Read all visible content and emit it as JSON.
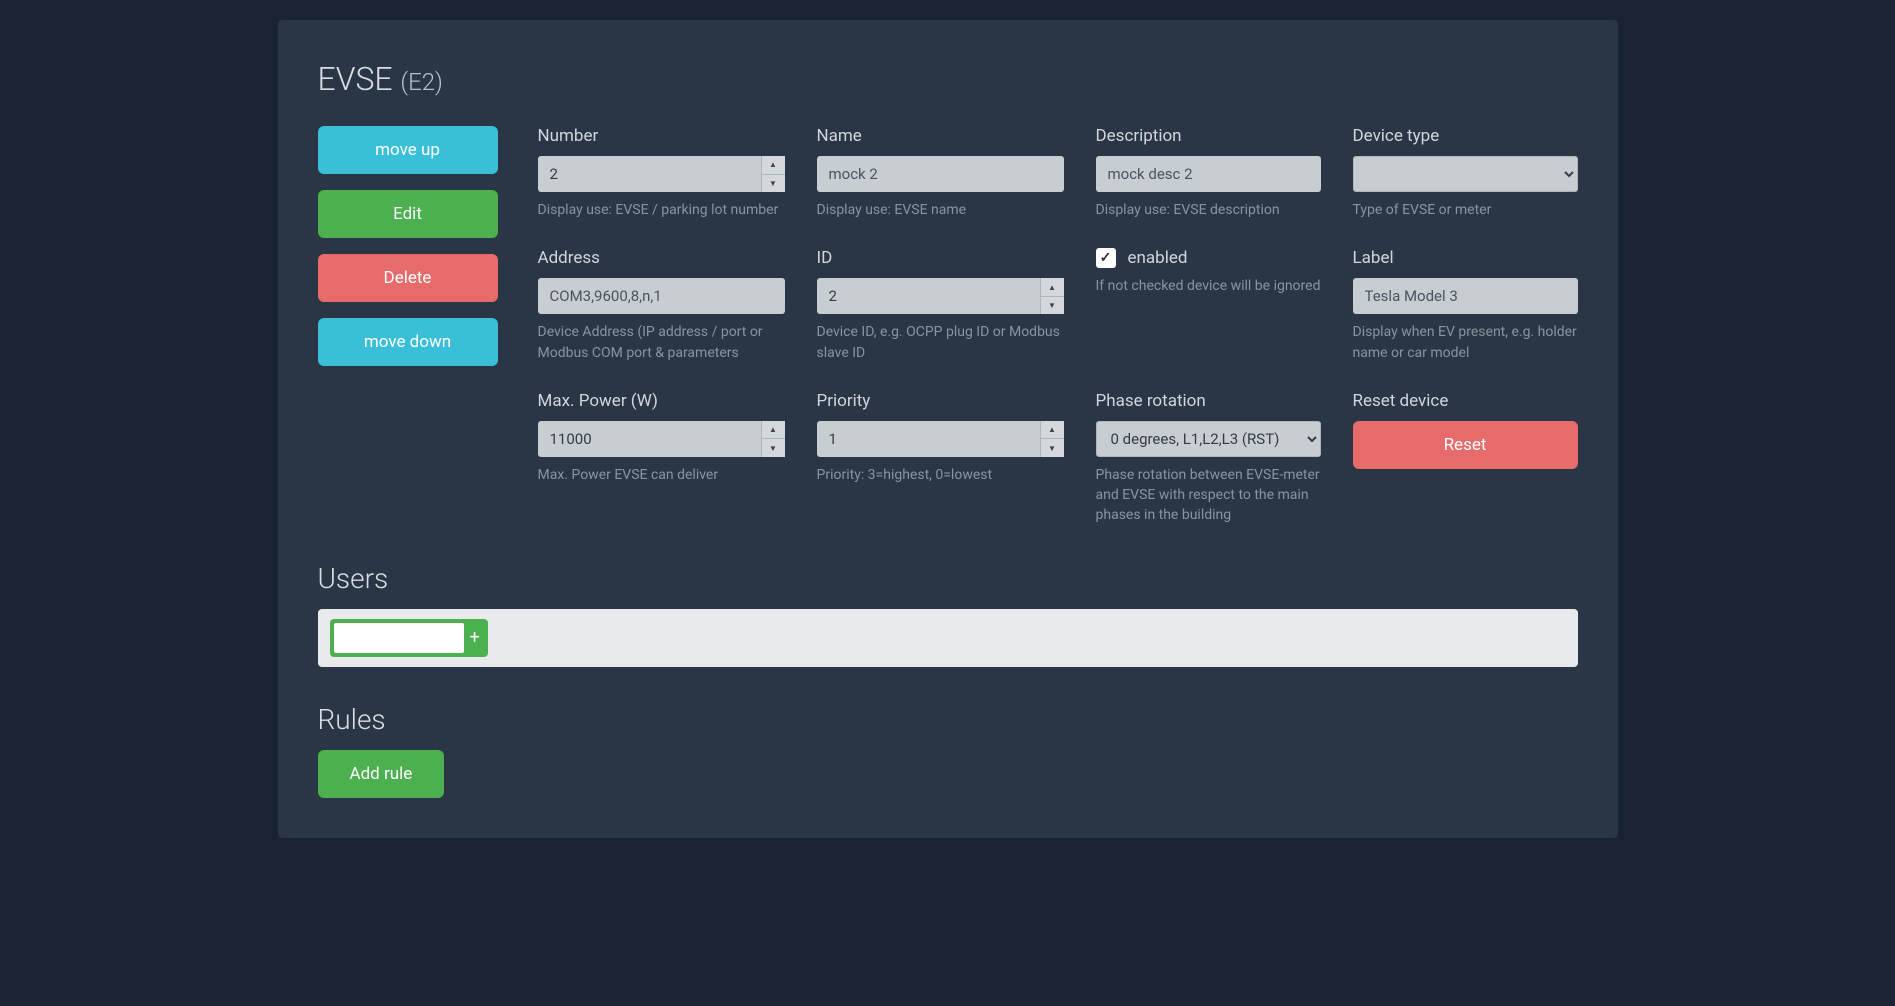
{
  "header": {
    "title": "EVSE",
    "subtitle": "(E2)"
  },
  "side": {
    "move_up": "move up",
    "edit": "Edit",
    "delete": "Delete",
    "move_down": "move down"
  },
  "fields": {
    "number": {
      "label": "Number",
      "value": "2",
      "help": "Display use: EVSE / parking lot number"
    },
    "name": {
      "label": "Name",
      "value": "mock 2",
      "help": "Display use: EVSE name"
    },
    "description": {
      "label": "Description",
      "value": "mock desc 2",
      "help": "Display use: EVSE description"
    },
    "device_type": {
      "label": "Device type",
      "value": "",
      "help": "Type of EVSE or meter"
    },
    "address": {
      "label": "Address",
      "value": "COM3,9600,8,n,1",
      "help": "Device Address (IP address / port or Modbus COM port & parameters"
    },
    "id": {
      "label": "ID",
      "value": "2",
      "help": "Device ID, e.g. OCPP plug ID or Modbus slave ID"
    },
    "enabled": {
      "label": "enabled",
      "checked": true,
      "help": "If not checked device will be ignored"
    },
    "evlabel": {
      "label": "Label",
      "value": "Tesla Model 3",
      "help": "Display when EV present, e.g. holder name or car model"
    },
    "max_power": {
      "label": "Max. Power (W)",
      "value": "11000",
      "help": "Max. Power EVSE can deliver"
    },
    "priority": {
      "label": "Priority",
      "value": "1",
      "help": "Priority: 3=highest, 0=lowest"
    },
    "phase_rotation": {
      "label": "Phase rotation",
      "value": "0 degrees, L1,L2,L3 (RST)",
      "help": "Phase rotation between EVSE-meter and EVSE with respect to the main phases in the building"
    },
    "reset": {
      "label": "Reset device",
      "button": "Reset"
    }
  },
  "users": {
    "header": "Users",
    "add_plus": "+"
  },
  "rules": {
    "header": "Rules",
    "add": "Add rule"
  }
}
